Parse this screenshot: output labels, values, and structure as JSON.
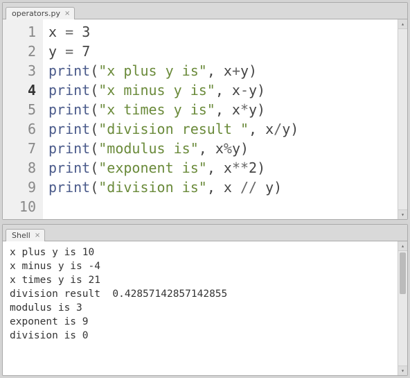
{
  "editor": {
    "tab_label": "operators.py",
    "current_line": 4,
    "lines": [
      {
        "n": 1,
        "tokens": [
          {
            "t": "x ",
            "c": ""
          },
          {
            "t": "=",
            "c": "op"
          },
          {
            "t": " ",
            "c": ""
          },
          {
            "t": "3",
            "c": "num"
          }
        ]
      },
      {
        "n": 2,
        "tokens": [
          {
            "t": "y ",
            "c": ""
          },
          {
            "t": "=",
            "c": "op"
          },
          {
            "t": " ",
            "c": ""
          },
          {
            "t": "7",
            "c": "num"
          }
        ]
      },
      {
        "n": 3,
        "tokens": [
          {
            "t": "",
            "c": ""
          }
        ]
      },
      {
        "n": 4,
        "tokens": [
          {
            "t": "print",
            "c": "fn"
          },
          {
            "t": "(",
            "c": ""
          },
          {
            "t": "\"x plus y is\"",
            "c": "str"
          },
          {
            "t": ", x",
            "c": ""
          },
          {
            "t": "+",
            "c": "op"
          },
          {
            "t": "y)",
            "c": ""
          }
        ]
      },
      {
        "n": 5,
        "tokens": [
          {
            "t": "print",
            "c": "fn"
          },
          {
            "t": "(",
            "c": ""
          },
          {
            "t": "\"x minus y is\"",
            "c": "str"
          },
          {
            "t": ", x",
            "c": ""
          },
          {
            "t": "-",
            "c": "op"
          },
          {
            "t": "y)",
            "c": ""
          }
        ]
      },
      {
        "n": 6,
        "tokens": [
          {
            "t": "print",
            "c": "fn"
          },
          {
            "t": "(",
            "c": ""
          },
          {
            "t": "\"x times y is\"",
            "c": "str"
          },
          {
            "t": ", x",
            "c": ""
          },
          {
            "t": "*",
            "c": "op"
          },
          {
            "t": "y)",
            "c": ""
          }
        ]
      },
      {
        "n": 7,
        "tokens": [
          {
            "t": "print",
            "c": "fn"
          },
          {
            "t": "(",
            "c": ""
          },
          {
            "t": "\"division result \"",
            "c": "str"
          },
          {
            "t": ", x",
            "c": ""
          },
          {
            "t": "/",
            "c": "op"
          },
          {
            "t": "y)",
            "c": ""
          }
        ]
      },
      {
        "n": 8,
        "tokens": [
          {
            "t": "print",
            "c": "fn"
          },
          {
            "t": "(",
            "c": ""
          },
          {
            "t": "\"modulus is\"",
            "c": "str"
          },
          {
            "t": ", x",
            "c": ""
          },
          {
            "t": "%",
            "c": "op"
          },
          {
            "t": "y)",
            "c": ""
          }
        ]
      },
      {
        "n": 9,
        "tokens": [
          {
            "t": "print",
            "c": "fn"
          },
          {
            "t": "(",
            "c": ""
          },
          {
            "t": "\"exponent is\"",
            "c": "str"
          },
          {
            "t": ", x",
            "c": ""
          },
          {
            "t": "**",
            "c": "op"
          },
          {
            "t": "2",
            "c": "num"
          },
          {
            "t": ")",
            "c": ""
          }
        ]
      },
      {
        "n": 10,
        "tokens": [
          {
            "t": "print",
            "c": "fn"
          },
          {
            "t": "(",
            "c": ""
          },
          {
            "t": "\"division is\"",
            "c": "str"
          },
          {
            "t": ", x ",
            "c": ""
          },
          {
            "t": "//",
            "c": "op"
          },
          {
            "t": " y)",
            "c": ""
          }
        ]
      }
    ]
  },
  "shell": {
    "tab_label": "Shell",
    "output": [
      "x plus y is 10",
      "x minus y is -4",
      "x times y is 21",
      "division result  0.42857142857142855",
      "modulus is 3",
      "exponent is 9",
      "division is 0"
    ]
  }
}
